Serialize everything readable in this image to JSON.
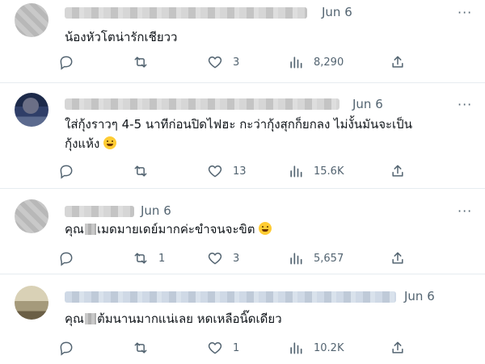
{
  "tweets": [
    {
      "date": "Jun 6",
      "text": "น้องหัวโตน่ารักเชียวว",
      "text_line2": "",
      "replies": "",
      "retweets": "",
      "likes": "3",
      "views": "8,290"
    },
    {
      "date": "Jun 6",
      "text": "ใส่กุ้งราวๆ 4-5 นาทีก่อนปิดไฟฮะ กะว่ากุ้งสุกก็ยกลง ไม่งั้นมันจะเป็น",
      "text_line2": "กุ้งแห้ง",
      "replies": "",
      "retweets": "",
      "likes": "13",
      "views": "15.6K"
    },
    {
      "date": "Jun 6",
      "text_pre": "คุณ",
      "text_post": "เมดมายเดย์มากค่ะขำจนจะขิต",
      "replies": "",
      "retweets": "1",
      "likes": "3",
      "views": "5,657"
    },
    {
      "date": "Jun 6",
      "text_pre": "คุณ",
      "text_post": "ต้มนานมากแน่เลย หดเหลือนิ๊ดเดียว",
      "replies": "",
      "retweets": "",
      "likes": "1",
      "views": "10.2K"
    }
  ],
  "more_label": "···",
  "icons": [
    "reply-icon",
    "retweet-icon",
    "like-icon",
    "views-icon",
    "share-icon",
    "more-icon",
    "emoji-icon"
  ],
  "colors": {
    "text": "#0f1419",
    "muted": "#536471",
    "border": "#e6ecf0"
  }
}
